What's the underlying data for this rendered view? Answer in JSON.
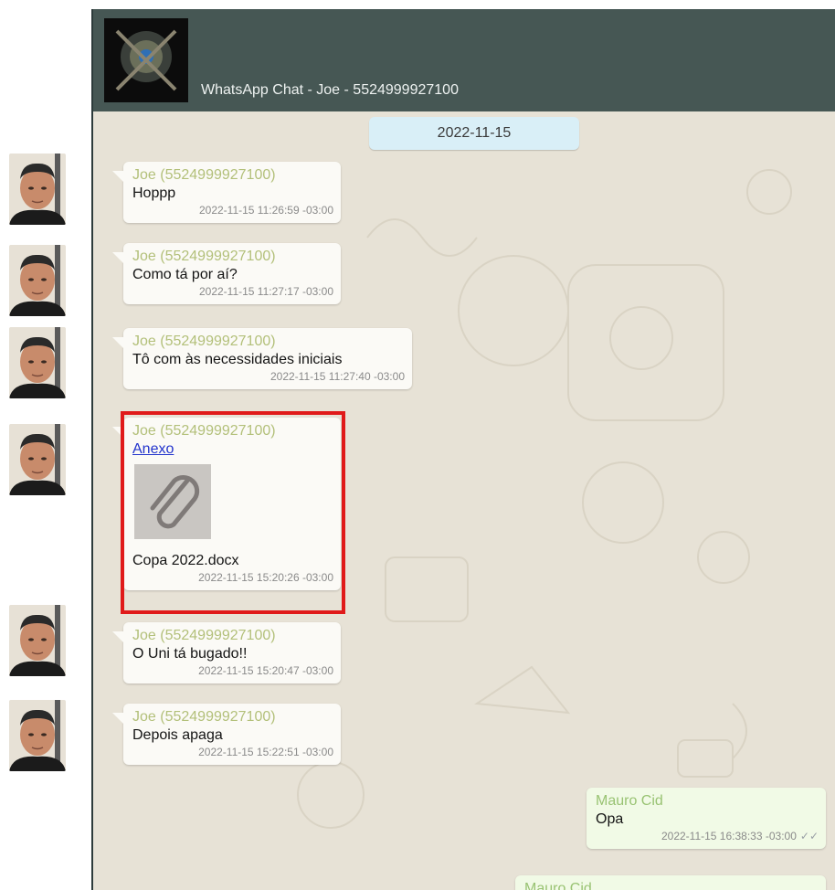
{
  "header": {
    "title": "WhatsApp Chat - Joe - 5524999927100"
  },
  "date_separator": "2022-11-15",
  "incoming": [
    {
      "sender": "Joe (5524999927100)",
      "text": "Hoppp",
      "time": "2022-11-15 11:26:59 -03:00"
    },
    {
      "sender": "Joe (5524999927100)",
      "text": "Como tá por aí?",
      "time": "2022-11-15 11:27:17 -03:00"
    },
    {
      "sender": "Joe (5524999927100)",
      "text": "Tô com às necessidades iniciais",
      "time": "2022-11-15 11:27:40 -03:00"
    },
    {
      "sender": "Joe (5524999927100)",
      "link": "Anexo",
      "filename": "Copa 2022.docx",
      "time": "2022-11-15 15:20:26 -03:00"
    },
    {
      "sender": "Joe (5524999927100)",
      "text": "O Uni tá bugado!!",
      "time": "2022-11-15 15:20:47 -03:00"
    },
    {
      "sender": "Joe (5524999927100)",
      "text": "Depois apaga",
      "time": "2022-11-15 15:22:51 -03:00"
    }
  ],
  "outgoing": [
    {
      "sender": "Mauro Cid",
      "text": "Opa",
      "time": "2022-11-15 16:38:33 -03:00",
      "ticks": "✓✓"
    },
    {
      "sender": "Mauro Cid"
    }
  ],
  "colors": {
    "header_bg": "#465754",
    "chat_bg": "#e7e2d6",
    "date_pill": "#d9eff7",
    "highlight": "#e01a1a",
    "sender_in": "#b3c07a",
    "sender_out": "#99c373"
  },
  "icons": {
    "attachment": "paperclip-icon",
    "read_receipt": "double-check-icon"
  }
}
